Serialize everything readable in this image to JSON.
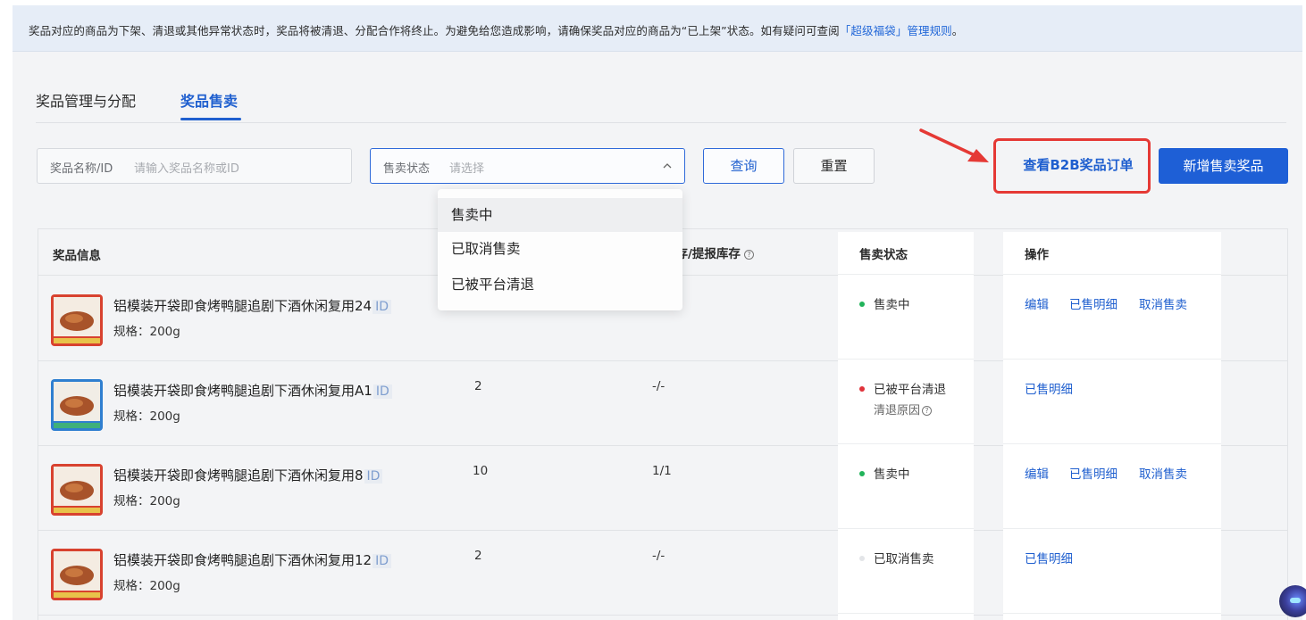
{
  "notice": {
    "text": "奖品对应的商品为下架、清退或其他异常状态时，奖品将被清退、分配合作将终止。为避免给您造成影响，请确保奖品对应的商品为“已上架”状态。如有疑问可查阅",
    "link": "「超级福袋」管理规则",
    "end": "。"
  },
  "tabs": [
    {
      "label": "奖品管理与分配"
    },
    {
      "label": "奖品售卖"
    }
  ],
  "filters": {
    "name_label": "奖品名称/ID",
    "name_placeholder": "请输入奖品名称或ID",
    "status_label": "售卖状态",
    "status_placeholder": "请选择"
  },
  "buttons": {
    "query": "查询",
    "reset": "重置",
    "b2b_orders": "查看B2B奖品订单",
    "add_prize": "新增售卖奖品"
  },
  "dropdown_options": [
    "售卖中",
    "已取消售卖",
    "已被平台清退"
  ],
  "table": {
    "headers": {
      "info": "奖品信息",
      "stock": "库存/提报库存",
      "status": "售卖状态",
      "ops": "操作"
    },
    "rows": [
      {
        "name": "铝模装开袋即食烤鸭腿追剧下酒休闲复用24",
        "id": "ID",
        "spec": "规格：200g",
        "sold": "",
        "stock": "",
        "status": "售卖中",
        "status_color": "#21b35a",
        "sub_status": "",
        "ops": [
          "编辑",
          "已售明细",
          "取消售卖"
        ]
      },
      {
        "name": "铝模装开袋即食烤鸭腿追剧下酒休闲复用A1",
        "id": "ID",
        "spec": "规格：200g",
        "sold": "2",
        "stock": "-/-",
        "status": "已被平台清退",
        "status_color": "#e0323a",
        "sub_status": "清退原因",
        "ops": [
          "已售明细"
        ]
      },
      {
        "name": "铝模装开袋即食烤鸭腿追剧下酒休闲复用8",
        "id": "ID",
        "spec": "规格：200g",
        "sold": "10",
        "stock": "1/1",
        "status": "售卖中",
        "status_color": "#21b35a",
        "sub_status": "",
        "ops": [
          "编辑",
          "已售明细",
          "取消售卖"
        ]
      },
      {
        "name": "铝模装开袋即食烤鸭腿追剧下酒休闲复用12",
        "id": "ID",
        "spec": "规格：200g",
        "sold": "2",
        "stock": "-/-",
        "status": "已取消售卖",
        "status_color": "#d5d7da",
        "sub_status": "",
        "ops": [
          "已售明细"
        ]
      }
    ]
  }
}
